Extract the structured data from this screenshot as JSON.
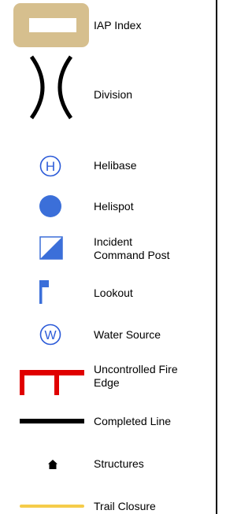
{
  "legend": {
    "items": [
      {
        "key": "iap-index",
        "label": "IAP Index",
        "color": "#d6bf8e"
      },
      {
        "key": "division",
        "label": "Division",
        "color": "#000000"
      },
      {
        "key": "helibase",
        "label": "Helibase",
        "symbol": "H",
        "color": "#2b5ad8"
      },
      {
        "key": "helispot",
        "label": "Helispot",
        "color": "#3b6fd9"
      },
      {
        "key": "incident-command-post",
        "label": "Incident\nCommand Post",
        "color": "#3b6fd9"
      },
      {
        "key": "lookout",
        "label": "Lookout",
        "color": "#3b6fd9"
      },
      {
        "key": "water-source",
        "label": "Water Source",
        "symbol": "W",
        "color": "#2b5ad8"
      },
      {
        "key": "uncontrolled-fire-edge",
        "label": "Uncontrolled Fire\nEdge",
        "color": "#e00000"
      },
      {
        "key": "completed-line",
        "label": "Completed Line",
        "color": "#000000"
      },
      {
        "key": "structures",
        "label": "Structures",
        "color": "#000000"
      },
      {
        "key": "trail-closure",
        "label": "Trail Closure",
        "color": "#f5cc4a"
      }
    ]
  }
}
